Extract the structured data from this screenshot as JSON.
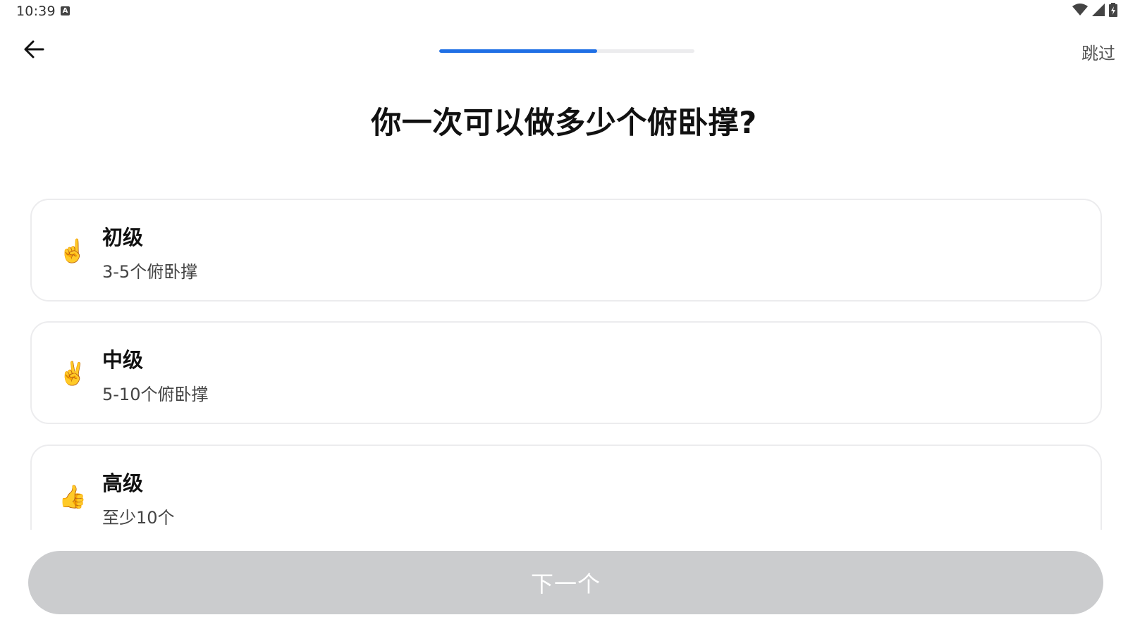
{
  "status_bar": {
    "time": "10:39",
    "indicator_letter": "A"
  },
  "nav": {
    "skip_label": "跳过",
    "progress_percent": 62
  },
  "question": {
    "title": "你一次可以做多少个俯卧撑?"
  },
  "options": [
    {
      "emoji": "☝️",
      "emoji_icon": "index-pointing-up-icon",
      "title": "初级",
      "desc": "3-5个俯卧撑"
    },
    {
      "emoji": "✌️",
      "emoji_icon": "victory-hand-icon",
      "title": "中级",
      "desc": "5-10个俯卧撑"
    },
    {
      "emoji": "👍",
      "emoji_icon": "thumbs-up-icon",
      "title": "高级",
      "desc": "至少10个"
    }
  ],
  "footer": {
    "next_label": "下一个"
  },
  "colors": {
    "accent": "#1f6fe5",
    "progress_track": "#ececee",
    "card_border": "#ececee",
    "button_disabled": "#cbccce"
  }
}
